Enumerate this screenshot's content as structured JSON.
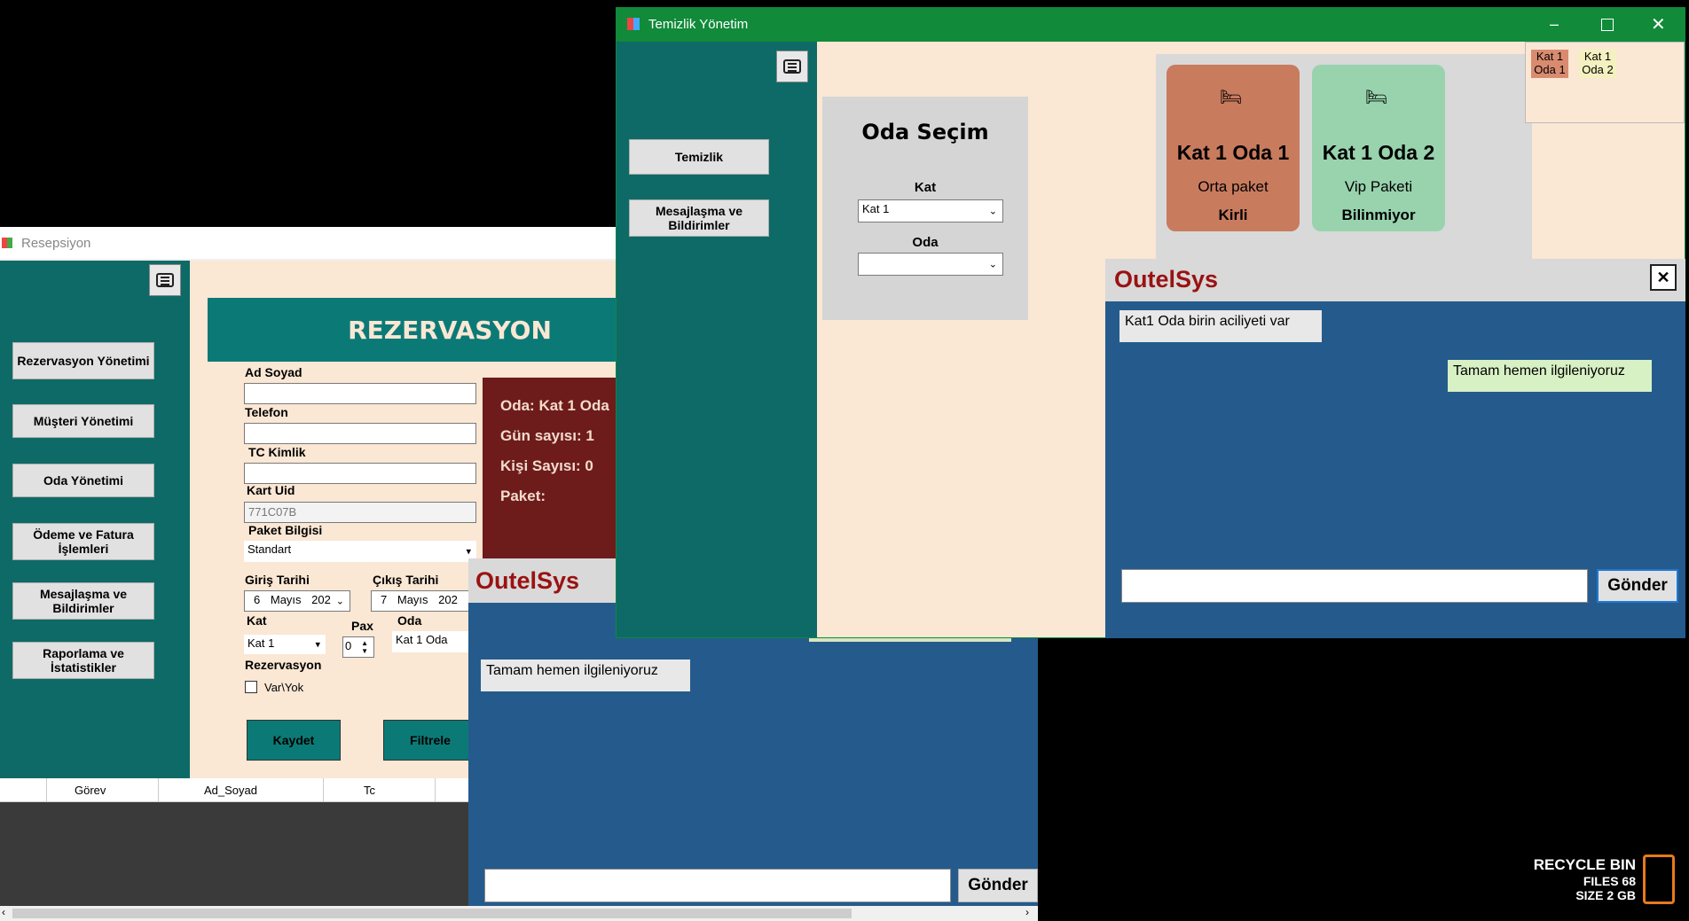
{
  "resepsiyon": {
    "title": "Resepsiyon",
    "nav": [
      "Rezervasyon Yönetimi",
      "Müşteri Yönetimi",
      "Oda Yönetimi",
      "Ödeme ve Fatura İşlemleri",
      "Mesajlaşma ve Bildirimler",
      "Raporlama ve İstatistikler"
    ],
    "header": "REZERVASYON",
    "labels": {
      "ad_soyad": "Ad Soyad",
      "telefon": "Telefon",
      "tc": "TC Kimlik",
      "kart": "Kart Uid",
      "paket": "Paket Bilgisi",
      "giris": "Giriş Tarihi",
      "cikis": "Çıkış Tarihi",
      "kat": "Kat",
      "pax": "Pax",
      "oda": "Oda",
      "rezervasyon": "Rezervasyon",
      "varyok": "Var\\Yok"
    },
    "values": {
      "kart_uid": "771C07B",
      "paket": "Standart",
      "giris_day": "6",
      "giris_month": "Mayıs",
      "giris_year": "202",
      "cikis_day": "7",
      "cikis_month": "Mayıs",
      "cikis_year": "202",
      "kat": "Kat 1",
      "pax": "0",
      "oda": "Kat 1 Oda"
    },
    "summary": {
      "oda": "Oda: Kat 1 Oda",
      "gun": "Gün sayısı: 1",
      "kisi": "Kişi Sayısı: 0",
      "paket": "Paket:"
    },
    "buttons": {
      "kaydet": "Kaydet",
      "filtrele": "Filtrele"
    },
    "grid_headers": [
      "Görev",
      "Ad_Soyad",
      "Tc"
    ]
  },
  "chat_back": {
    "title": "OutelSys",
    "message": "Tamam hemen ilgileniyoruz",
    "send": "Gönder"
  },
  "temizlik": {
    "title": "Temizlik Yönetim",
    "nav": [
      "Temizlik",
      "Mesajlaşma ve Bildirimler"
    ],
    "oda_secim": "Oda Seçim",
    "kat_label": "Kat",
    "kat_value": "Kat 1",
    "oda_label": "Oda",
    "rooms": [
      {
        "name": "Kat 1 Oda 1",
        "paket": "Orta paket",
        "status": "Kirli",
        "color": "#c97b5e"
      },
      {
        "name": "Kat 1 Oda 2",
        "paket": "Vip Paketi",
        "status": "Bilinmiyor",
        "color": "#98d3ae"
      }
    ],
    "mini_rooms": [
      {
        "line1": "Kat 1",
        "line2": "Oda 1"
      },
      {
        "line1": "Kat 1",
        "line2": "Oda 2"
      }
    ]
  },
  "chat_front": {
    "title": "OutelSys",
    "incoming": "Kat1 Oda birin aciliyeti var",
    "outgoing": "Tamam hemen ilgileniyoruz",
    "send": "Gönder"
  },
  "recycle": {
    "title": "RECYCLE BIN",
    "files": "FILES 68",
    "size": "SIZE 2 GB"
  }
}
